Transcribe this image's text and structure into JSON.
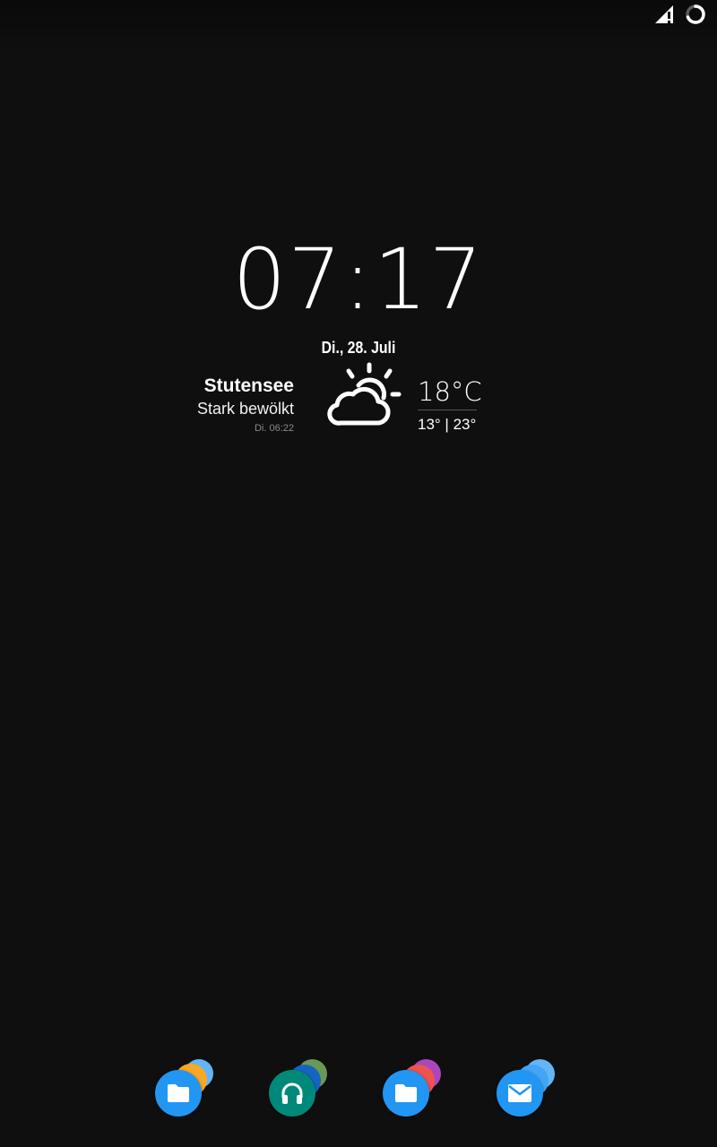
{
  "status_bar": {
    "icons": [
      "signal-no-data-icon",
      "loading-ring-icon"
    ]
  },
  "clock": {
    "time": "07:17"
  },
  "date": {
    "text": "Di., 28. Juli"
  },
  "weather": {
    "city": "Stutensee",
    "condition": "Stark bewölkt",
    "updated": "Di. 06:22",
    "temperature": "18°C",
    "range": "13° | 23°",
    "icon": "partly-cloudy-icon"
  },
  "dock": {
    "items": [
      {
        "name": "folder-1",
        "icon": "folder-icon",
        "main_color": "#2196f3",
        "stack_colors": [
          "#64b5f6",
          "#f9a825"
        ]
      },
      {
        "name": "folder-2",
        "icon": "headphones-icon",
        "main_color": "#00897b",
        "stack_colors": [
          "#6a9955",
          "#1565c0"
        ]
      },
      {
        "name": "folder-3",
        "icon": "folder-icon",
        "main_color": "#2196f3",
        "stack_colors": [
          "#ab47bc",
          "#ef5350"
        ]
      },
      {
        "name": "folder-4",
        "icon": "email-icon",
        "main_color": "#2196f3",
        "stack_colors": [
          "#64b5f6",
          "#42a5f5"
        ]
      }
    ]
  }
}
